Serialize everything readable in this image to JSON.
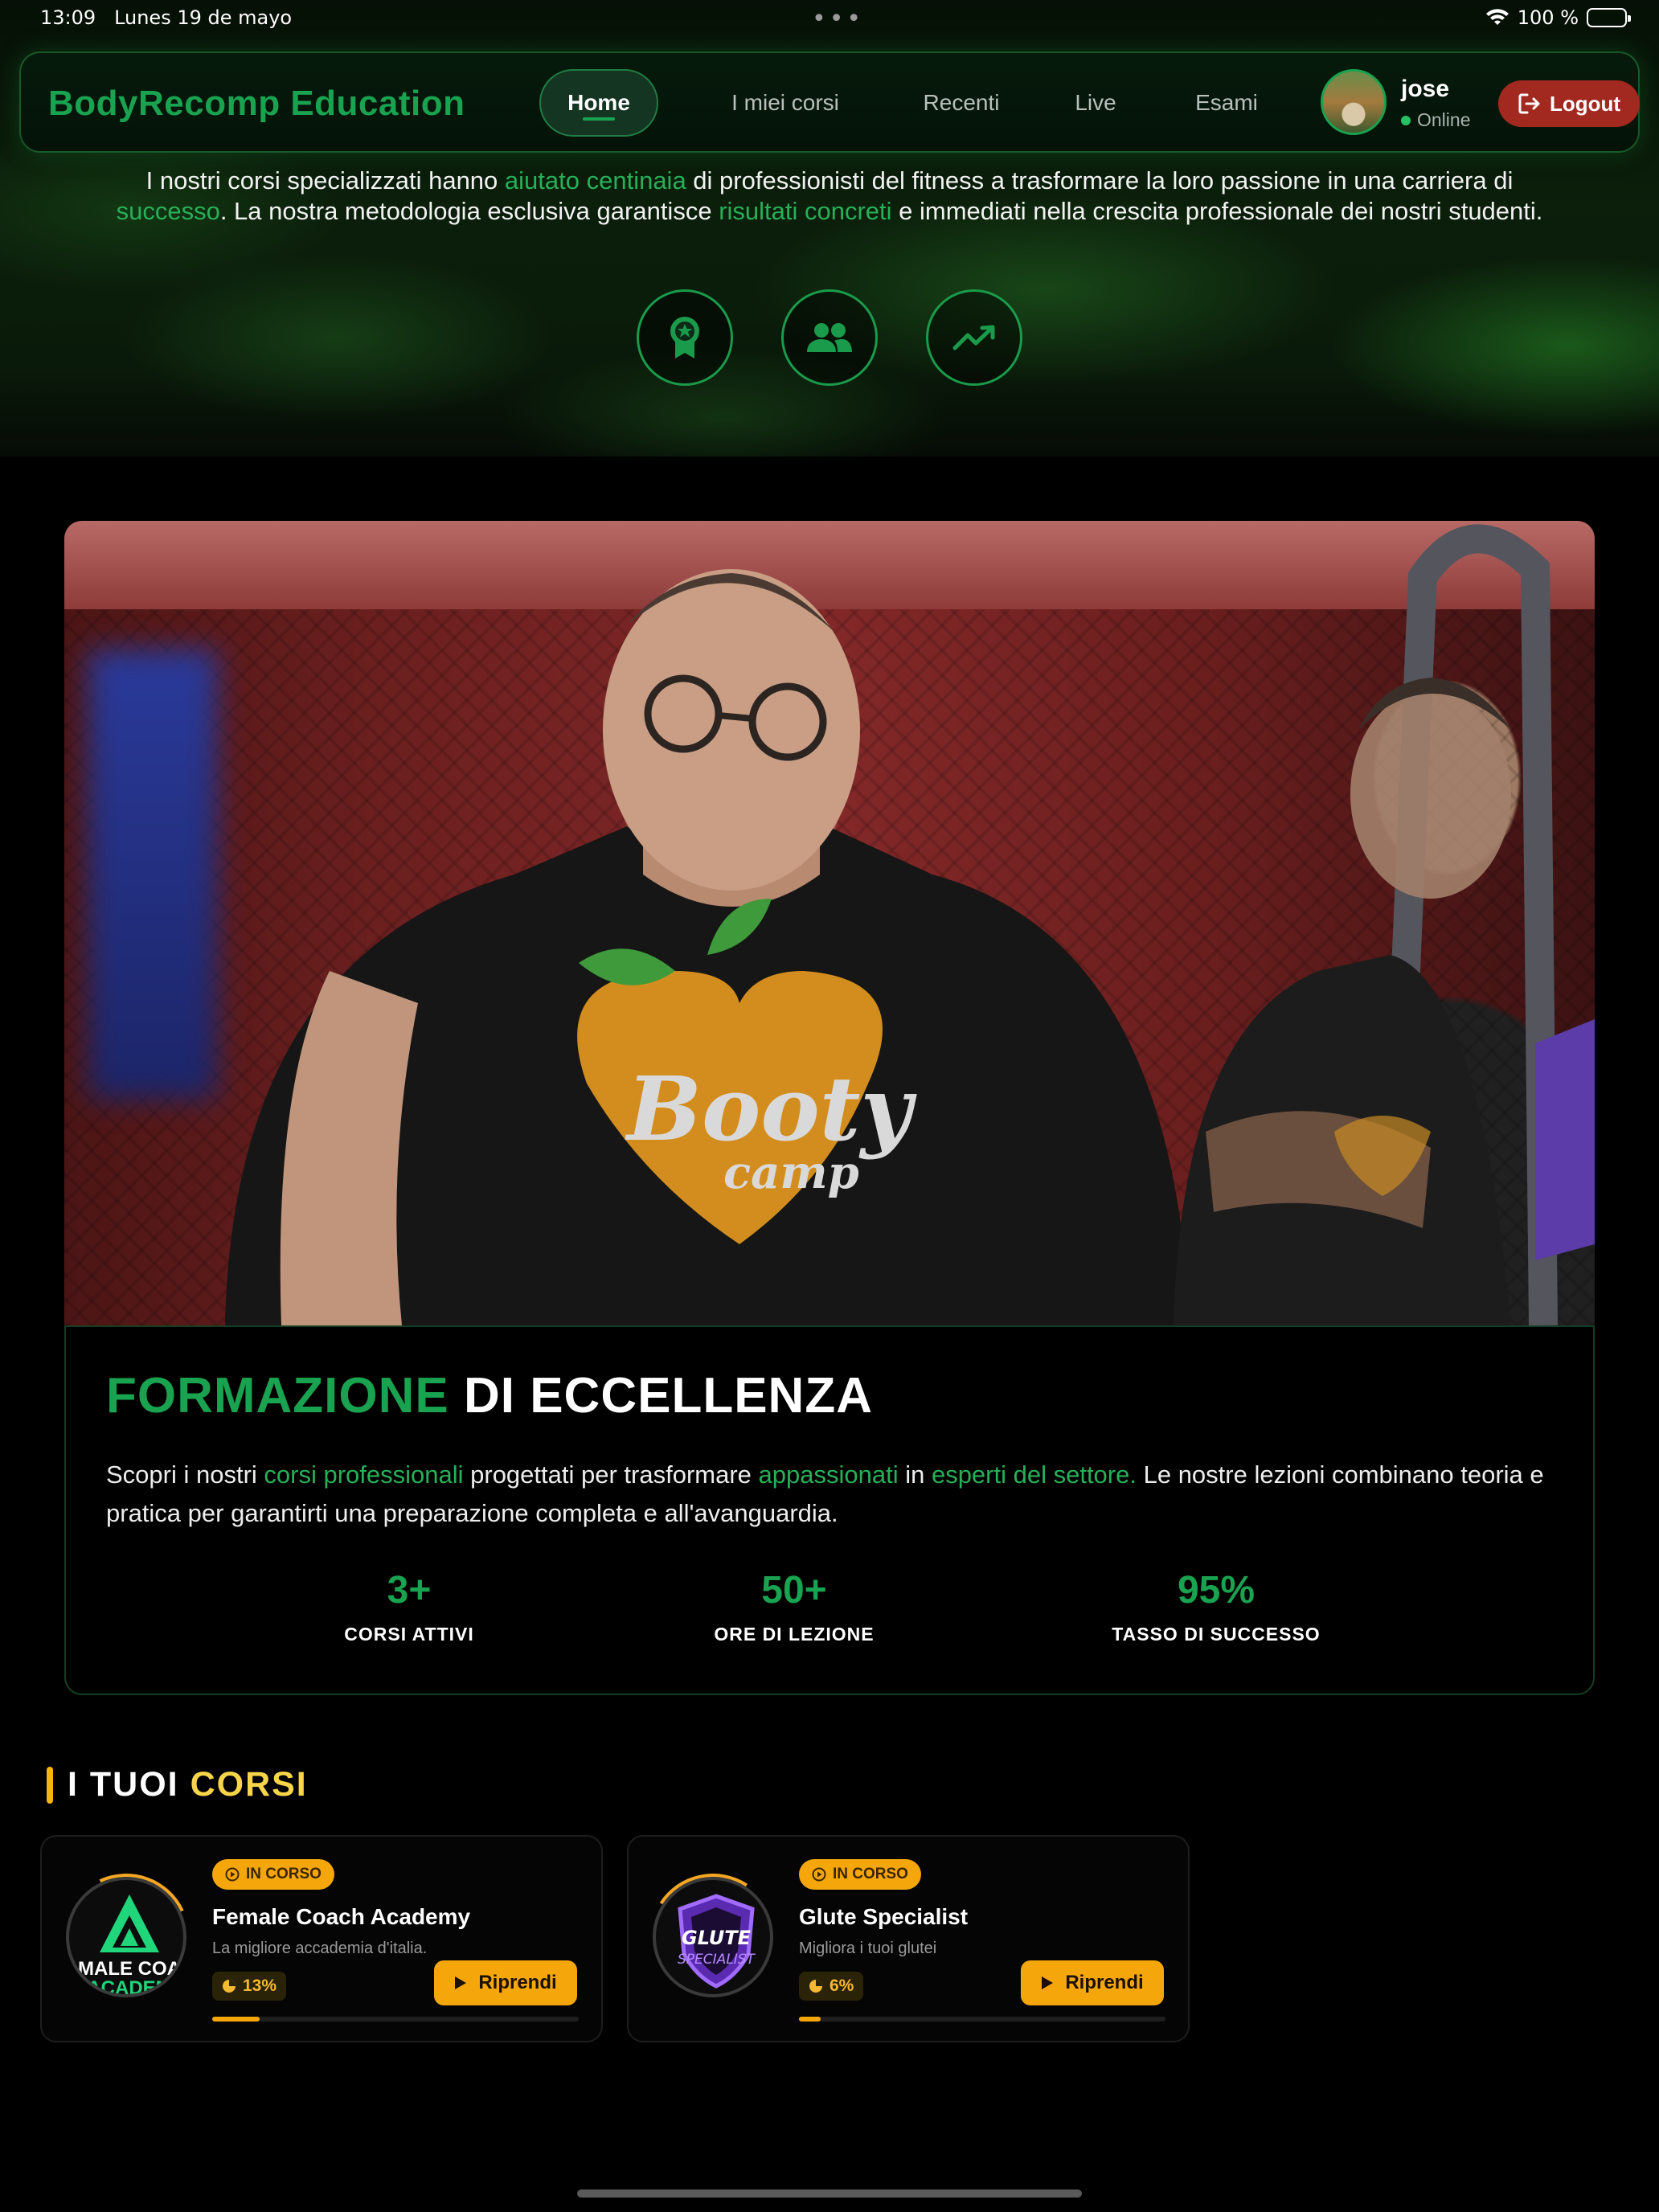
{
  "status_bar": {
    "time": "13:09",
    "date": "Lunes 19 de mayo",
    "dots": "•••",
    "battery": "100 %"
  },
  "nav": {
    "brand": "BodyRecomp Education",
    "items": [
      {
        "label": "Home",
        "active": true
      },
      {
        "label": "I miei corsi",
        "active": false
      },
      {
        "label": "Recenti",
        "active": false
      },
      {
        "label": "Live",
        "active": false
      },
      {
        "label": "Esami",
        "active": false
      }
    ],
    "user": {
      "name": "jose",
      "status": "Online"
    },
    "logout_label": "Logout"
  },
  "intro": {
    "t1": "I nostri corsi specializzati hanno ",
    "h1": "aiutato centinaia",
    "t2": " di professionisti del fitness a trasformare la loro passione in una carriera di ",
    "h2": "successo",
    "t3": ". La nostra metodologia esclusiva garantisce ",
    "h3": "risultati concreti",
    "t4": " e immediati nella crescita professionale dei nostri studenti."
  },
  "feature_icons": [
    "award-icon",
    "users-icon",
    "trending-up-icon"
  ],
  "info": {
    "title_green": "FORMAZIONE",
    "title_white": " DI ECCELLENZA",
    "p1": "Scopri i nostri ",
    "h1": "corsi professionali",
    "p2": " progettati per trasformare ",
    "h2": "appassionati",
    "p3": " in ",
    "h3": "esperti del settore.",
    "p4": " Le nostre lezioni combinano teoria e pratica per garantirti una preparazione completa e all'avanguardia.",
    "stats": [
      {
        "value": "3+",
        "label": "CORSI ATTIVI"
      },
      {
        "value": "50+",
        "label": "ORE DI LEZIONE"
      },
      {
        "value": "95%",
        "label": "TASSO DI SUCCESSO"
      }
    ]
  },
  "courses_section": {
    "title_white": "I TUOI ",
    "title_yellow": "CORSI"
  },
  "courses": [
    {
      "badge": "IN CORSO",
      "title": "Female Coach Academy",
      "subtitle": "La migliore accademia d'italia.",
      "progress_label": "13%",
      "progress": 0.13,
      "resume_label": "Riprendi",
      "logo_text_1": "MALE COA",
      "logo_text_2": "ACADEM"
    },
    {
      "badge": "IN CORSO",
      "title": "Glute Specialist",
      "subtitle": "Migliora i tuoi glutei",
      "progress_label": "6%",
      "progress": 0.06,
      "resume_label": "Riprendi",
      "logo_text_1": "GLUTE",
      "logo_text_2": "SPECIALIST"
    }
  ],
  "colors": {
    "accent_green": "#19a24f",
    "accent_yellow": "#f5a60a",
    "logout_red": "#a1291f"
  },
  "photo": {
    "shirt_text_1": "Booty",
    "shirt_text_2": "camp"
  }
}
